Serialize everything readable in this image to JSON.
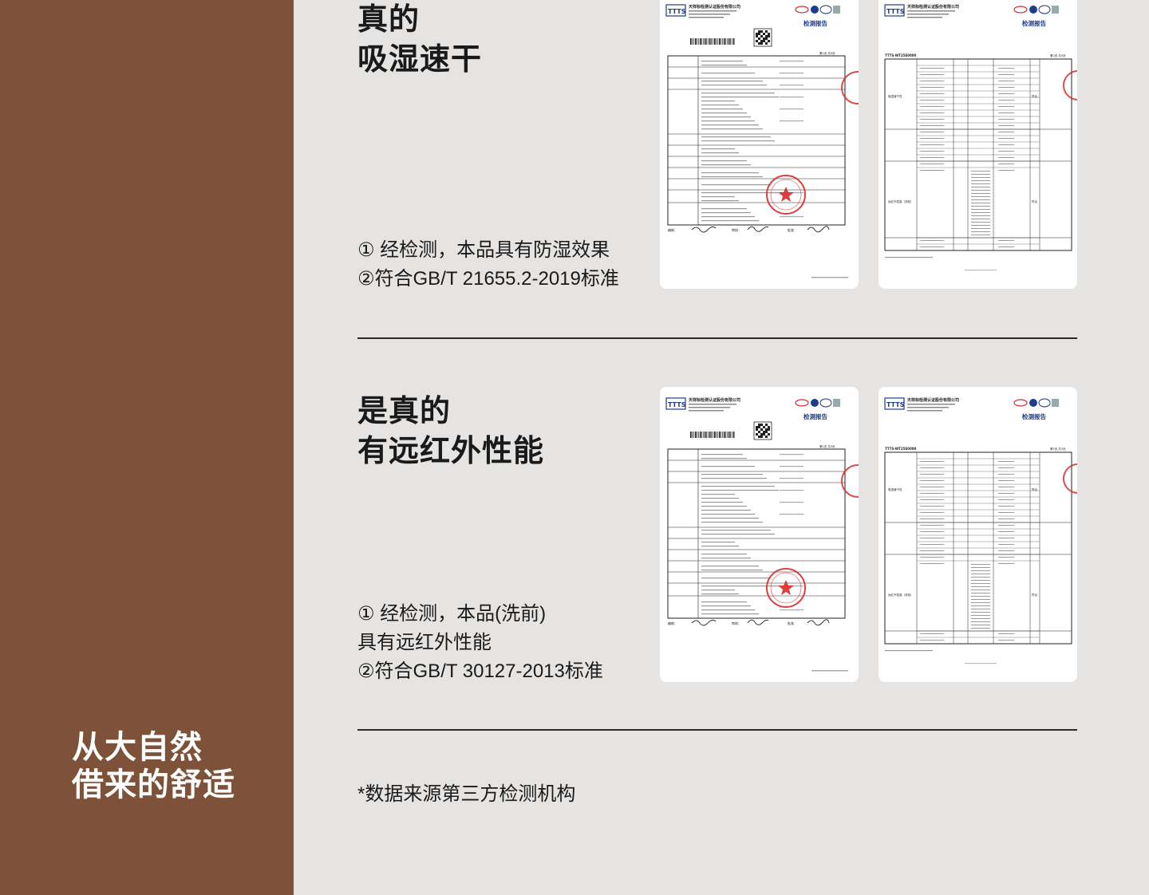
{
  "colors": {
    "sidebar": "#7d5238",
    "background": "#e6e4e2",
    "stamp": "#d92b2b",
    "logo_blue": "#1e3c8c"
  },
  "sidebar": {
    "slogan_line1": "从大自然",
    "slogan_line2": "借来的舒适"
  },
  "sections": [
    {
      "heading_line1": "真的",
      "heading_line2": "吸湿速干",
      "desc_lines": [
        "① 经检测，本品具有防湿效果",
        "②符合GB/T 21655.2-2019标准"
      ]
    },
    {
      "heading_line1": "是真的",
      "heading_line2": "有远红外性能",
      "desc_lines": [
        "① 经检测，本品(洗前)",
        "具有远红外性能",
        "②符合GB/T 30127-2013标准"
      ]
    }
  ],
  "footnote": "*数据来源第三方检测机构",
  "report": {
    "company": "天祥标检测认证股份有限公司",
    "logo": "TTTS",
    "title": "检测报告",
    "page_cover": "第1页 共5页",
    "page_table": "第2页 共5页",
    "report_no": "TTTS-WT25E0000",
    "row_humid_fast": "吸湿速干性",
    "row_far_ir": "远红外性能（洗前）",
    "row_conclusion": "符合",
    "sig_1": "编制：",
    "sig_2": "审核：",
    "sig_3": "批准：",
    "stamp_icon": "stamp-star-icon"
  }
}
